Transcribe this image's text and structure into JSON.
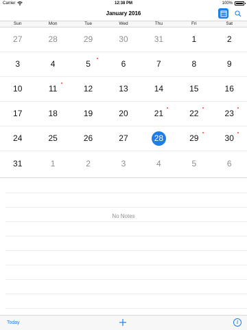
{
  "status_bar": {
    "carrier": "Carrier",
    "time": "12:38 PM",
    "battery": "100%"
  },
  "nav": {
    "title": "January 2016",
    "calendar_icon": "calendar-grid-icon",
    "search_icon": "search-icon"
  },
  "weekdays": [
    "Sun",
    "Mon",
    "Tue",
    "Wed",
    "Thu",
    "Fri",
    "Sat"
  ],
  "weeks": [
    [
      {
        "d": "27",
        "other": true
      },
      {
        "d": "28",
        "other": true
      },
      {
        "d": "29",
        "other": true
      },
      {
        "d": "30",
        "other": true
      },
      {
        "d": "31",
        "other": true
      },
      {
        "d": "1"
      },
      {
        "d": "2"
      }
    ],
    [
      {
        "d": "3"
      },
      {
        "d": "4"
      },
      {
        "d": "5",
        "dot": true
      },
      {
        "d": "6"
      },
      {
        "d": "7"
      },
      {
        "d": "8"
      },
      {
        "d": "9"
      }
    ],
    [
      {
        "d": "10"
      },
      {
        "d": "11",
        "dot": true
      },
      {
        "d": "12"
      },
      {
        "d": "13"
      },
      {
        "d": "14"
      },
      {
        "d": "15"
      },
      {
        "d": "16"
      }
    ],
    [
      {
        "d": "17"
      },
      {
        "d": "18"
      },
      {
        "d": "19"
      },
      {
        "d": "20"
      },
      {
        "d": "21",
        "dot": true
      },
      {
        "d": "22",
        "dot": true
      },
      {
        "d": "23",
        "dot": true
      }
    ],
    [
      {
        "d": "24"
      },
      {
        "d": "25"
      },
      {
        "d": "26"
      },
      {
        "d": "27"
      },
      {
        "d": "28",
        "selected": true
      },
      {
        "d": "29",
        "dot": true
      },
      {
        "d": "30",
        "dot": true
      }
    ],
    [
      {
        "d": "31"
      },
      {
        "d": "1",
        "other": true
      },
      {
        "d": "2",
        "other": true
      },
      {
        "d": "3",
        "other": true
      },
      {
        "d": "4",
        "other": true
      },
      {
        "d": "5",
        "other": true
      },
      {
        "d": "6",
        "other": true
      }
    ]
  ],
  "notes": {
    "empty_text": "No Notes"
  },
  "toolbar": {
    "today_label": "Today",
    "add_icon": "plus-icon",
    "info_icon": "info-icon",
    "info_glyph": "i"
  },
  "colors": {
    "accent": "#1e7ee6",
    "note_dot": "#ff3b30",
    "muted": "#8e8e93"
  }
}
